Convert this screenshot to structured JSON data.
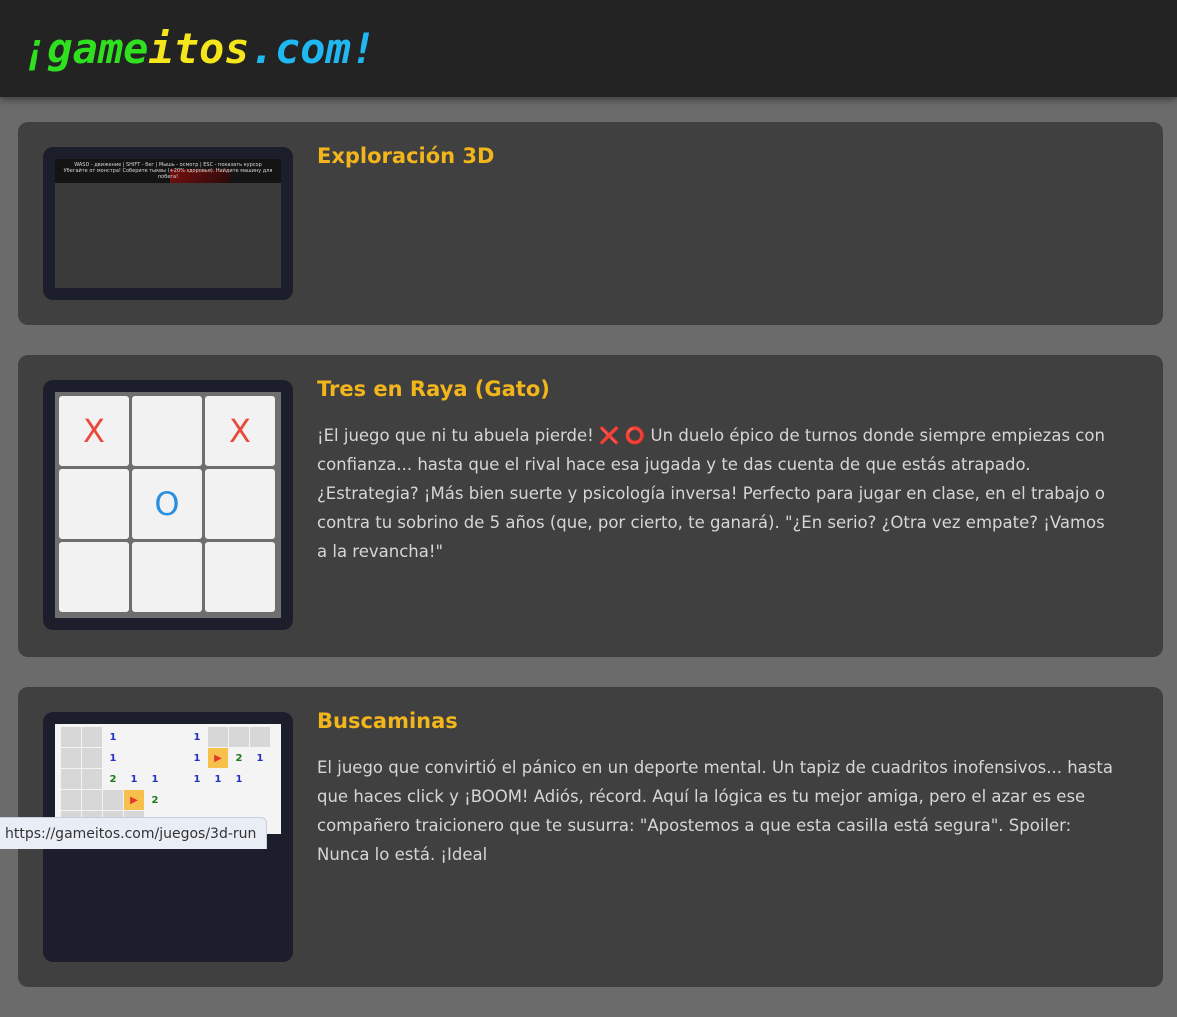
{
  "site": {
    "logo_part1": "¡game",
    "logo_part2": "itos",
    "logo_part3": ".com!"
  },
  "games": [
    {
      "title": "Exploración 3D",
      "thumb_line1": "WASD - движение | SHIFT - бег | Мышь - осмотр | ESC - показать курсор",
      "thumb_line2": "Убегайте от монстра! Соберите тыквы (+20% здоровья). Найдите машину для побега!"
    },
    {
      "title": "Tres en Raya (Gato)",
      "description": "¡El juego que ni tu abuela pierde! ❌ ⭕ Un duelo épico de turnos donde siempre empiezas con confianza... hasta que el rival hace esa jugada y te das cuenta de que estás atrapado. ¿Estrategia? ¡Más bien suerte y psicología inversa! Perfecto para jugar en clase, en el trabajo o contra tu sobrino de 5 años (que, por cierto, te ganará). \"¿En serio? ¿Otra vez empate? ¡Vamos a la revancha!\"",
      "board": [
        "X",
        "",
        "X",
        "",
        "O",
        "",
        "",
        "",
        ""
      ]
    },
    {
      "title": "Buscaminas",
      "description": "El juego que convirtió el pánico en un deporte mental. Un tapiz de cuadritos inofensivos... hasta que haces click y ¡BOOM! Adiós, récord. Aquí la lógica es tu mejor amiga, pero el azar es ese compañero traicionero que te susurra: \"Apostemos a que esta casilla está segura\". Spoiler: Nunca lo está. ¡Ideal",
      "grid": [
        [
          "h",
          "h",
          "1",
          "r",
          "r",
          "r",
          "1",
          "h",
          "h",
          "h"
        ],
        [
          "h",
          "h",
          "1",
          "r",
          "r",
          "r",
          "1",
          "f",
          "2",
          "1"
        ],
        [
          "h",
          "h",
          "2",
          "1",
          "1",
          "r",
          "1",
          "1",
          "1",
          "r"
        ],
        [
          "h",
          "h",
          "h",
          "f",
          "2",
          "r",
          "r",
          "r",
          "r",
          "r"
        ],
        [
          "h",
          "h",
          "h",
          "h",
          "r",
          "r",
          "r",
          "r",
          "r",
          "r"
        ]
      ]
    }
  ],
  "status_url": "https://gameitos.com/juegos/3d-run"
}
